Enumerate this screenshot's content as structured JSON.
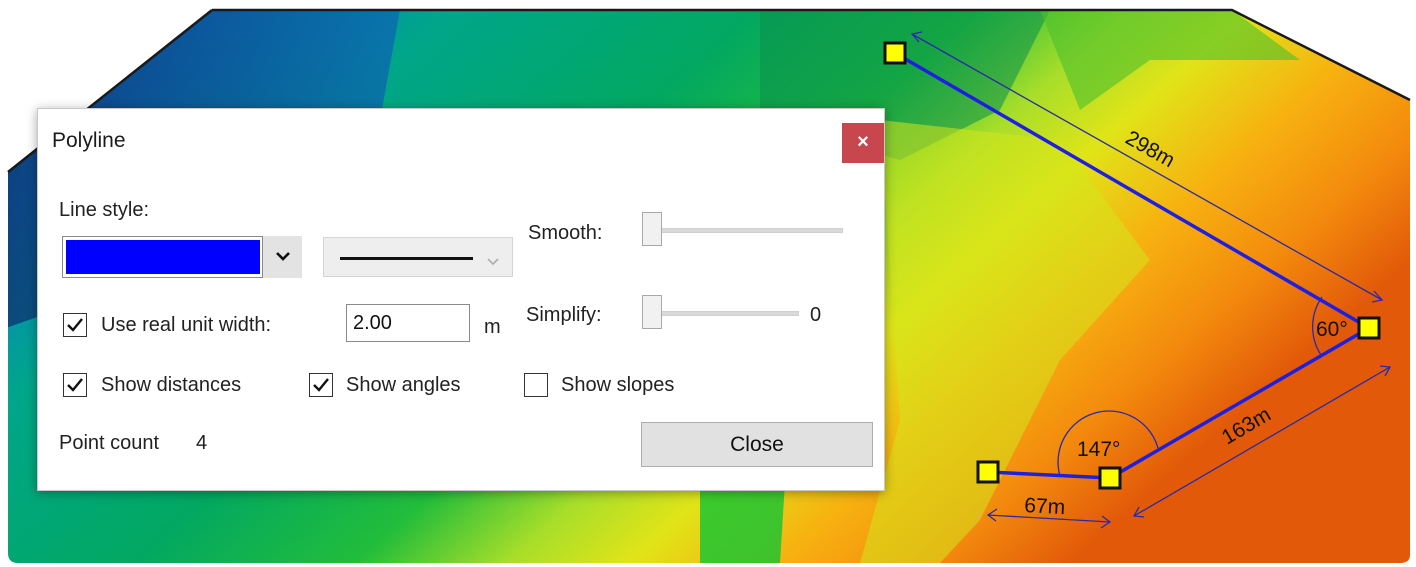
{
  "map": {
    "distance_labels": [
      "298m",
      "163m",
      "67m"
    ],
    "angle_labels": [
      "60°",
      "147°"
    ],
    "polyline_color": "#1f1fe0",
    "vertex_color": "#ffff00",
    "dimension_line_color": "#2a2aa8"
  },
  "dialog": {
    "title": "Polyline",
    "close_icon": "close-icon",
    "close_glyph": "×",
    "line_style_label": "Line style:",
    "line_color": "#0000ff",
    "smooth_label": "Smooth:",
    "smooth_value": 0,
    "simplify_label": "Simplify:",
    "simplify_value": 0,
    "simplify_value_text": "0",
    "use_real_unit_width": {
      "label": "Use real unit width:",
      "checked": true
    },
    "width_value": "2.00",
    "width_unit": "m",
    "show_distances": {
      "label": "Show distances",
      "checked": true
    },
    "show_angles": {
      "label": "Show angles",
      "checked": true
    },
    "show_slopes": {
      "label": "Show slopes",
      "checked": false
    },
    "point_count_label": "Point count",
    "point_count": "4",
    "close_button": "Close"
  }
}
